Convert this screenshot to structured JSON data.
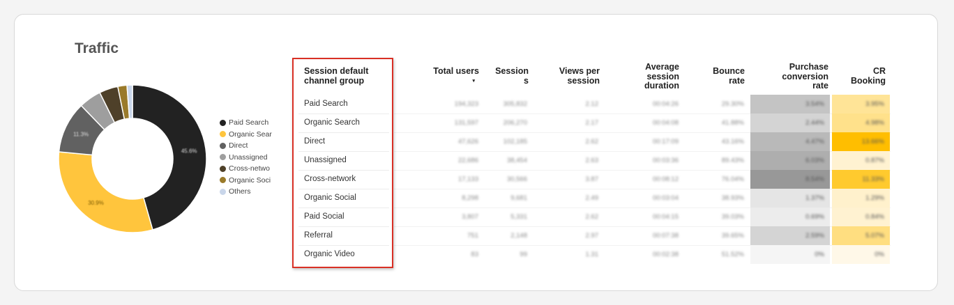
{
  "title": "Traffic",
  "donut": {
    "slices": [
      {
        "name": "Paid Search",
        "value": 45.6,
        "color": "#222222",
        "label": "45.6%"
      },
      {
        "name": "Organic Search",
        "value": 30.9,
        "color": "#ffc53d",
        "label": "30.9%"
      },
      {
        "name": "Direct",
        "value": 11.3,
        "color": "#616161",
        "label": "11.3%"
      },
      {
        "name": "Unassigned",
        "value": 4.9,
        "color": "#9e9e9e",
        "label": ""
      },
      {
        "name": "Cross-network",
        "value": 4.1,
        "color": "#4e4029",
        "label": ""
      },
      {
        "name": "Organic Social",
        "value": 2.0,
        "color": "#9a7a2a",
        "label": ""
      },
      {
        "name": "Others",
        "value": 1.2,
        "color": "#c9d6ea",
        "label": ""
      }
    ]
  },
  "legend": [
    "Paid Search",
    "Organic Sear",
    "Direct",
    "Unassigned",
    "Cross-netwo",
    "Organic Soci",
    "Others"
  ],
  "table": {
    "headers": {
      "channel": [
        "Session default",
        "channel group"
      ],
      "total_users": [
        "Total users"
      ],
      "sort_indicator": "▾",
      "sessions": [
        "Session",
        "s"
      ],
      "views_per_session": [
        "Views per",
        "session"
      ],
      "avg_duration": [
        "Average",
        "session",
        "duration"
      ],
      "bounce_rate": [
        "Bounce",
        "rate"
      ],
      "purchase_cr": [
        "Purchase",
        "conversion",
        "rate"
      ],
      "cr_booking": [
        "CR",
        "Booking"
      ]
    },
    "rows": [
      {
        "channel": "Paid Search",
        "users": "194,323",
        "sessions": "305,832",
        "vps": "2.12",
        "dur": "00:04:26",
        "bounce": "29.30%",
        "pcr": "3.54%",
        "pcr_level": 0.45,
        "crb": "3.95%",
        "crb_level": 0.35
      },
      {
        "channel": "Organic Search",
        "users": "131,597",
        "sessions": "206,270",
        "vps": "2.17",
        "dur": "00:04:08",
        "bounce": "41.88%",
        "pcr": "2.44%",
        "pcr_level": 0.3,
        "crb": "4.98%",
        "crb_level": 0.4
      },
      {
        "channel": "Direct",
        "users": "47,626",
        "sessions": "102,185",
        "vps": "2.62",
        "dur": "00:17:09",
        "bounce": "43.16%",
        "pcr": "4.47%",
        "pcr_level": 0.55,
        "crb": "13.66%",
        "crb_level": 1.0
      },
      {
        "channel": "Unassigned",
        "users": "22,686",
        "sessions": "38,454",
        "vps": "2.63",
        "dur": "00:03:36",
        "bounce": "89.43%",
        "pcr": "6.03%",
        "pcr_level": 0.65,
        "crb": "0.87%",
        "crb_level": 0.1
      },
      {
        "channel": "Cross-network",
        "users": "17,133",
        "sessions": "30,566",
        "vps": "3.87",
        "dur": "00:08:12",
        "bounce": "76.04%",
        "pcr": "8.54%",
        "pcr_level": 0.85,
        "crb": "11.33%",
        "crb_level": 0.8
      },
      {
        "channel": "Organic Social",
        "users": "8,298",
        "sessions": "9,681",
        "vps": "2.49",
        "dur": "00:03:04",
        "bounce": "38.93%",
        "pcr": "1.37%",
        "pcr_level": 0.15,
        "crb": "1.29%",
        "crb_level": 0.12
      },
      {
        "channel": "Paid Social",
        "users": "3,807",
        "sessions": "5,331",
        "vps": "2.62",
        "dur": "00:04:15",
        "bounce": "39.03%",
        "pcr": "0.69%",
        "pcr_level": 0.08,
        "crb": "0.84%",
        "crb_level": 0.1
      },
      {
        "channel": "Referral",
        "users": "751",
        "sessions": "2,148",
        "vps": "2.97",
        "dur": "00:07:38",
        "bounce": "39.65%",
        "pcr": "2.59%",
        "pcr_level": 0.3,
        "crb": "5.07%",
        "crb_level": 0.45
      },
      {
        "channel": "Organic Video",
        "users": "83",
        "sessions": "99",
        "vps": "1.31",
        "dur": "00:02:38",
        "bounce": "51.52%",
        "pcr": "0%",
        "pcr_level": 0.0,
        "crb": "0%",
        "crb_level": 0.0
      }
    ]
  }
}
